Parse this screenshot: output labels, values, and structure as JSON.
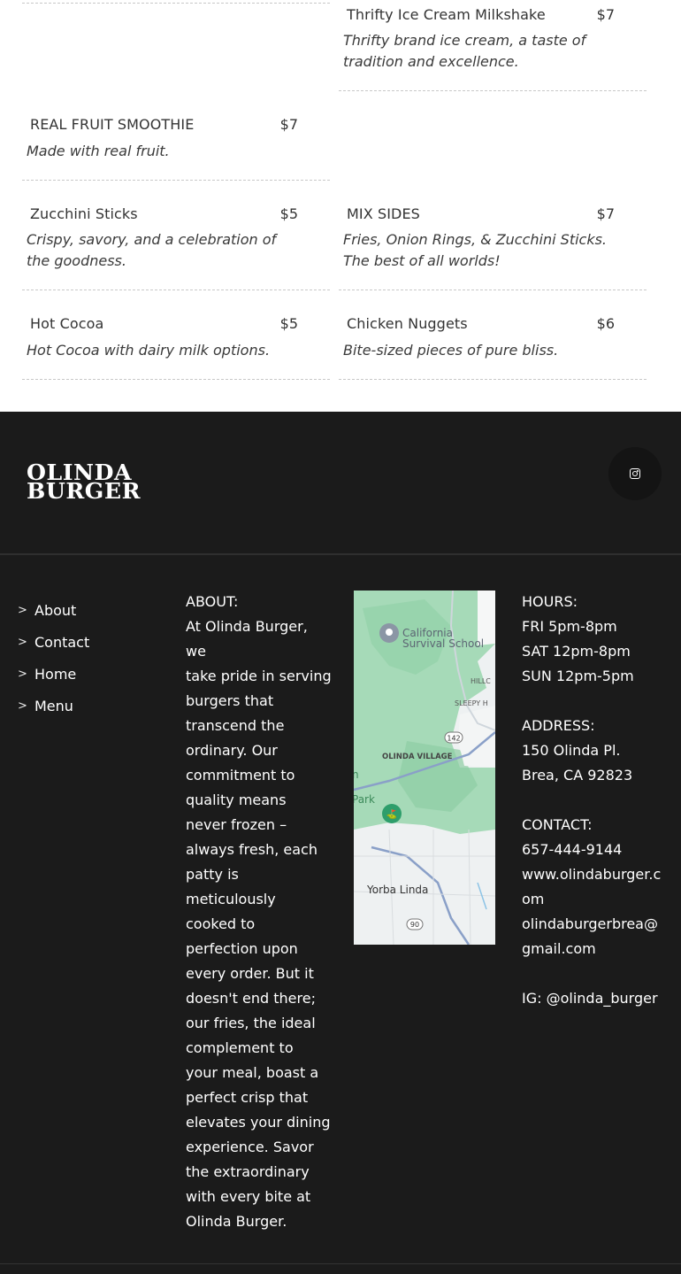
{
  "menu": {
    "items": [
      {
        "name": "Thrifty Ice Cream Milkshake",
        "price": "$7",
        "desc_lines": [
          "Thrifty brand ice cream, a taste of",
          "tradition and excellence."
        ]
      },
      {
        "name": "REAL FRUIT SMOOTHIE",
        "price": "$7",
        "desc_lines": [
          "Made with real fruit."
        ]
      },
      {
        "name": "Zucchini Sticks",
        "price": "$5",
        "desc_lines": [
          "Crispy, savory, and a celebration of",
          "the goodness."
        ]
      },
      {
        "name": "MIX SIDES",
        "price": "$7",
        "desc_lines": [
          "Fries, Onion Rings, & Zucchini Sticks.",
          "The best of all worlds!"
        ]
      },
      {
        "name": "Hot Cocoa",
        "price": "$5",
        "desc_lines": [
          "Hot Cocoa with dairy milk options."
        ]
      },
      {
        "name": "Chicken Nuggets",
        "price": "$6",
        "desc_lines": [
          "Bite-sized pieces of pure bliss."
        ]
      }
    ]
  },
  "footer": {
    "logo": {
      "line1": "OLINDA",
      "line2": "BURGER"
    },
    "social": {
      "icon": "instagram-icon"
    },
    "nav": [
      {
        "label": "About",
        "icon": "chevron-right-icon"
      },
      {
        "label": "Contact",
        "icon": "chevron-right-icon"
      },
      {
        "label": "Home",
        "icon": "chevron-right-icon"
      },
      {
        "label": "Menu",
        "icon": "chevron-right-icon"
      }
    ],
    "about": {
      "heading": "ABOUT:",
      "lines": [
        "At Olinda Burger, we",
        "take pride in serving",
        "burgers that",
        "transcend the",
        "ordinary. Our",
        "commitment to",
        "quality means",
        "never frozen –",
        "always fresh, each",
        "patty is",
        "meticulously",
        "cooked to",
        "perfection upon",
        "every order. But it",
        "doesn't end there;",
        "our fries, the ideal",
        "complement to",
        "your meal, boast a",
        "perfect crisp that",
        "elevates your dining",
        "experience. Savor",
        "the extraordinary",
        "with every bite at",
        "Olinda Burger."
      ]
    },
    "map": {
      "labels": {
        "poi": "California",
        "poi2": "Survival School",
        "hill": "HILLC",
        "sleepy": "SLEEPY H",
        "route142": "142",
        "village": "OLINDA VILLAGE",
        "park_n": "n",
        "park": "Park",
        "city": "Yorba Linda",
        "route90": "90"
      },
      "colors": {
        "green": "#9ed6b0",
        "green_dark": "#6cc08a",
        "road": "#8aa0c8",
        "pin": "#2e9e6b",
        "base": "#eef1f2"
      }
    },
    "info": {
      "hours_heading": "HOURS:",
      "hours": [
        "FRI 5pm-8pm",
        "SAT 12pm-8pm",
        "SUN 12pm-5pm"
      ],
      "address_heading": "ADDRESS:",
      "address": [
        "150 Olinda Pl.",
        "Brea, CA 92823"
      ],
      "contact_heading": "CONTACT:",
      "contact": [
        "657-444-9144",
        "www.olindaburger.c",
        "om",
        "olindaburgerbrea@",
        "gmail.com"
      ],
      "ig": "IG: @olinda_burger"
    }
  }
}
